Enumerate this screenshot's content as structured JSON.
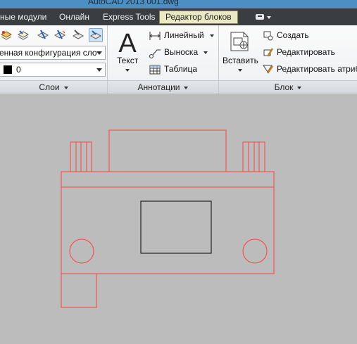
{
  "window": {
    "title": "AutoCAD 2013    001.dwg"
  },
  "menu": {
    "tabs": [
      {
        "label": "ные модули"
      },
      {
        "label": "Онлайн"
      },
      {
        "label": "Express Tools"
      },
      {
        "label": "Редактор блоков"
      }
    ]
  },
  "layers_panel": {
    "config_combo": "енная конфигурация сло",
    "layer_combo": "0",
    "title": "Слои"
  },
  "annotations_panel": {
    "text_label": "Текст",
    "linear_label": "Линейный",
    "leader_label": "Выноска",
    "table_label": "Таблица",
    "title": "Аннотации"
  },
  "block_panel": {
    "insert_label": "Вставить",
    "create_label": "Создать",
    "edit_label": "Редактировать",
    "edit_attr_label": "Редактировать атриб",
    "title": "Блок"
  },
  "colors": {
    "accent_tab": "#eae9c4",
    "drawing_red": "#ff4040",
    "canvas_bg": "#bcbcbc"
  }
}
